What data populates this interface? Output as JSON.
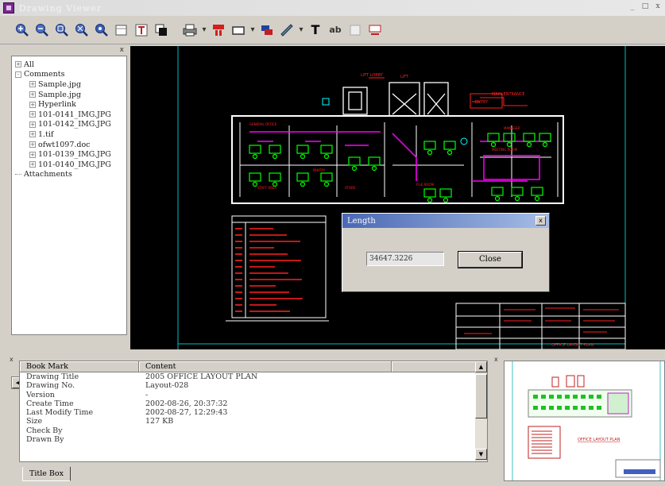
{
  "window": {
    "title": "Drawing Viewer",
    "controls": [
      "_",
      "□",
      "x"
    ]
  },
  "toolbar": {
    "icons": [
      "zoom-in-icon",
      "zoom-out-icon",
      "zoom-window-icon",
      "zoom-fit-icon",
      "zoom-realtime-icon",
      "select-icon",
      "textbox-icon",
      "layer-icon",
      "print-icon",
      "markup-icon",
      "rectangle-icon",
      "stamp-icon",
      "measure-icon",
      "text-icon",
      "find-icon",
      "compare-icon",
      "snapshot-icon"
    ],
    "text_tool_glyph": "T",
    "find_glyph": "ab"
  },
  "tree": {
    "items": [
      {
        "label": "All",
        "level": 0,
        "expander": "+"
      },
      {
        "label": "Comments",
        "level": 0,
        "expander": "-"
      },
      {
        "label": "Sample.jpg",
        "level": 1,
        "expander": "+"
      },
      {
        "label": "Sample.jpg",
        "level": 1,
        "expander": "+"
      },
      {
        "label": "Hyperlink",
        "level": 1,
        "expander": "+"
      },
      {
        "label": "101-0141_IMG.JPG",
        "level": 1,
        "expander": "+"
      },
      {
        "label": "101-0142_IMG.JPG",
        "level": 1,
        "expander": "+"
      },
      {
        "label": "1.tif",
        "level": 1,
        "expander": "+"
      },
      {
        "label": "ofwt1097.doc",
        "level": 1,
        "expander": "+"
      },
      {
        "label": "101-0139_IMG.JPG",
        "level": 1,
        "expander": "+"
      },
      {
        "label": "101-0140_IMG.JPG",
        "level": 1,
        "expander": "+"
      },
      {
        "label": "Attachments",
        "level": 0,
        "expander": ""
      }
    ]
  },
  "dialog": {
    "title": "Length",
    "value": "34647.3226",
    "button": "Close",
    "close_glyph": "x"
  },
  "properties": {
    "columns": [
      "Book Mark",
      "Content"
    ],
    "rows": [
      {
        "key": "Drawing Title",
        "value": "2005 OFFICE LAYOUT PLAN"
      },
      {
        "key": "Drawing No.",
        "value": "Layout-028"
      },
      {
        "key": "Version",
        "value": "-"
      },
      {
        "key": "Create Time",
        "value": "2002-08-26, 20:37:32"
      },
      {
        "key": "Last Modify Time",
        "value": "2002-08-27, 12:29:43"
      },
      {
        "key": "Size",
        "value": "127 KB"
      },
      {
        "key": "Check By",
        "value": ""
      },
      {
        "key": "Drawn By",
        "value": ""
      }
    ],
    "tab_label": "Title Box"
  },
  "colors": {
    "canvas_bg": "#000000",
    "cad_white": "#ffffff",
    "cad_green": "#00ff00",
    "cad_red": "#ff2020",
    "cad_magenta": "#ff00ff",
    "cad_cyan": "#00ffff",
    "dialog_title": "#4a68b4"
  }
}
